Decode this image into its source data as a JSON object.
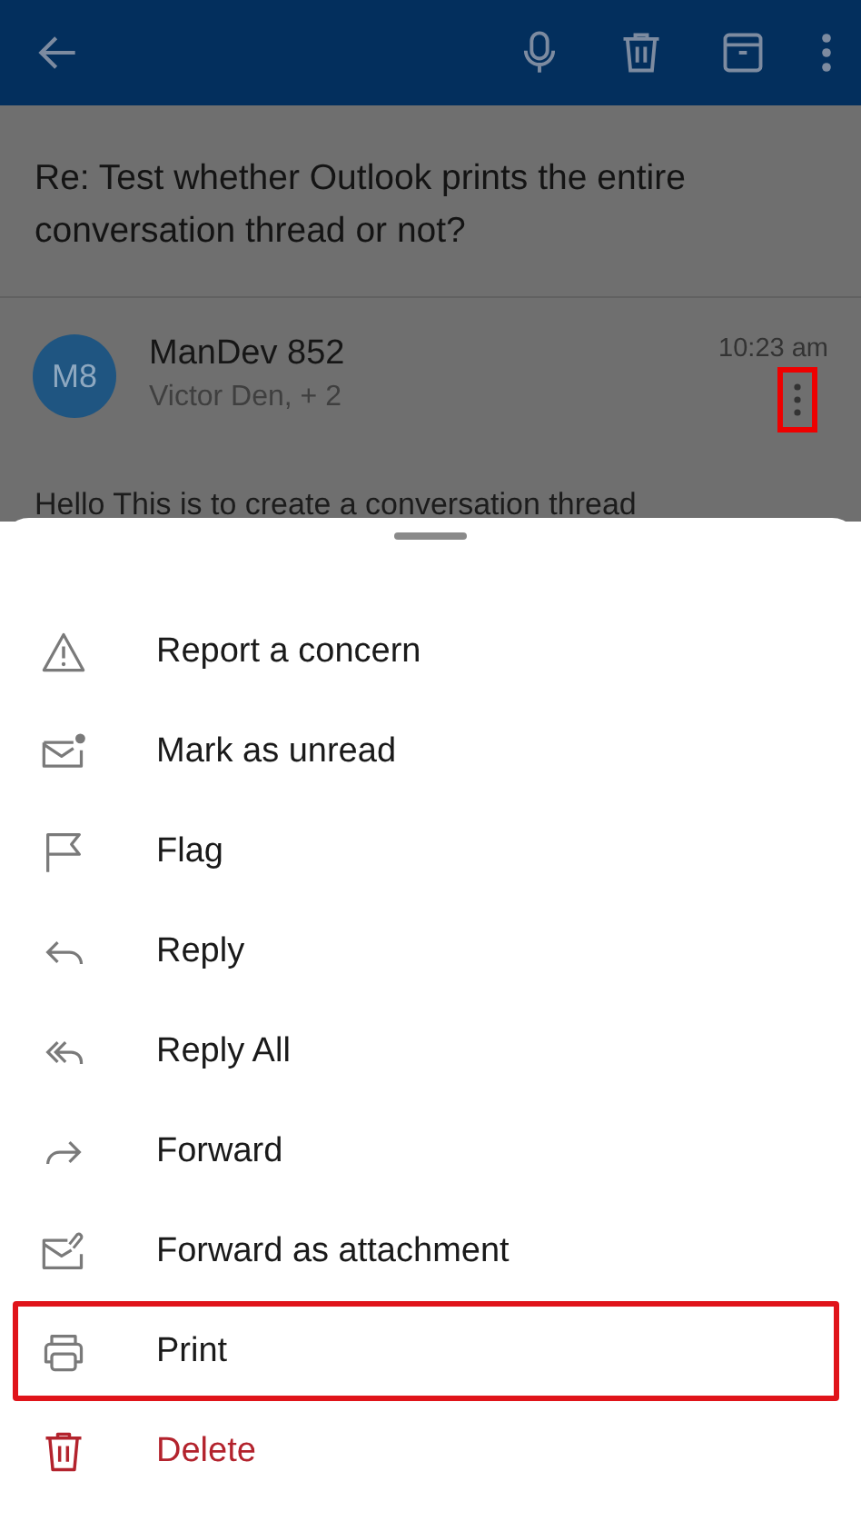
{
  "message": {
    "subject": "Re: Test whether Outlook prints the entire conversation thread or not?",
    "avatar": "M8",
    "sender": "ManDev 852",
    "recipients": "Victor Den, + 2",
    "time": "10:23 am",
    "more_highlighted": true,
    "body": "Hello This is to create a conversation thread"
  },
  "menu": [
    {
      "label": "Report a concern",
      "highlighted": false,
      "destructive": false
    },
    {
      "label": "Mark as unread",
      "highlighted": false,
      "destructive": false
    },
    {
      "label": "Flag",
      "highlighted": false,
      "destructive": false
    },
    {
      "label": "Reply",
      "highlighted": false,
      "destructive": false
    },
    {
      "label": "Reply All",
      "highlighted": false,
      "destructive": false
    },
    {
      "label": "Forward",
      "highlighted": false,
      "destructive": false
    },
    {
      "label": "Forward as attachment",
      "highlighted": false,
      "destructive": false
    },
    {
      "label": "Print",
      "highlighted": true,
      "destructive": false
    },
    {
      "label": "Delete",
      "highlighted": false,
      "destructive": true
    }
  ]
}
